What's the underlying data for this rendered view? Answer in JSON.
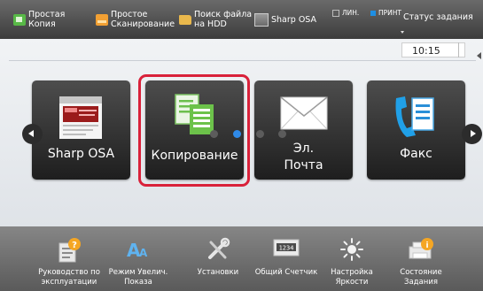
{
  "top_bar": {
    "shortcuts": [
      {
        "label_line1": "Простая",
        "label_line2": "Копия",
        "icon": "copy-icon"
      },
      {
        "label_line1": "Простое",
        "label_line2": "Сканирование",
        "icon": "scan-icon"
      },
      {
        "label_line1": "Поиск файла",
        "label_line2": "на HDD",
        "icon": "folder-icon"
      },
      {
        "label_line1": "Sharp OSA",
        "label_line2": "",
        "icon": "osa-icon"
      }
    ],
    "line_status": "ЛИН.",
    "print_status": "ПРИНТ",
    "job_status": "Статус задания"
  },
  "clock": "10:15",
  "tiles": [
    {
      "label": "Sharp OSA",
      "icon": "sharp-osa-icon"
    },
    {
      "label": "Копирование",
      "icon": "copy-icon"
    },
    {
      "label_line1": "Эл.",
      "label_line2": "Почта",
      "icon": "envelope-icon"
    },
    {
      "label": "Факс",
      "icon": "fax-icon"
    }
  ],
  "selected_tile": "Копирование",
  "pagination": {
    "total_pages": 4,
    "current_page": 2
  },
  "bottom_bar": [
    {
      "line1": "Руководство по",
      "line2": "эксплуатации",
      "icon": "manual-icon"
    },
    {
      "line1": "Режим Увелич.",
      "line2": "Показа",
      "icon": "zoom-text-icon"
    },
    {
      "line1": "Установки",
      "line2": "",
      "icon": "settings-icon"
    },
    {
      "line1": "Общий Счетчик",
      "line2": "",
      "icon": "counter-icon"
    },
    {
      "line1": "Настройка",
      "line2": "Яркости",
      "icon": "brightness-icon"
    },
    {
      "line1": "Состояние",
      "line2": "Задания",
      "icon": "job-status-icon"
    }
  ],
  "colors": {
    "highlight": "#d9213a",
    "active_dot": "#2f8ae8",
    "status_on": "#1e8fe3"
  }
}
